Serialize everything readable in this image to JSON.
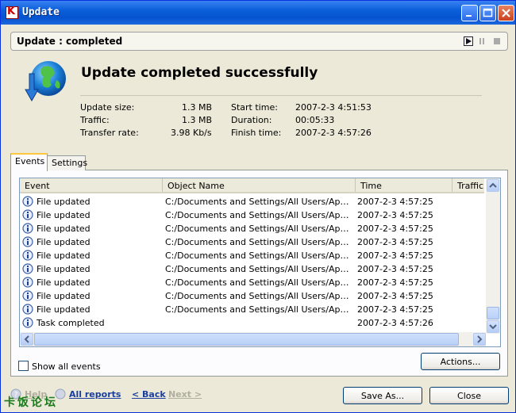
{
  "window": {
    "title": "Update"
  },
  "status": {
    "text": "Update : completed"
  },
  "headline": "Update completed successfully",
  "stats": {
    "update_size_label": "Update size:",
    "update_size_value": "1.3 MB",
    "traffic_label": "Traffic:",
    "traffic_value": "1.3 MB",
    "transfer_rate_label": "Transfer rate:",
    "transfer_rate_value": "3.98 Kb/s",
    "start_time_label": "Start time:",
    "start_time_value": "2007-2-3 4:51:53",
    "duration_label": "Duration:",
    "duration_value": "00:05:33",
    "finish_time_label": "Finish time:",
    "finish_time_value": "2007-2-3 4:57:26"
  },
  "tabs": [
    {
      "label": "Events"
    },
    {
      "label": "Settings"
    }
  ],
  "table": {
    "columns": [
      "Event",
      "Object Name",
      "Time",
      "Traffic"
    ],
    "rows": [
      {
        "event": "File updated",
        "object": "C:/Documents and Settings/All Users/Application Data/Kaspersky",
        "time": "2007-2-3 4:57:25"
      },
      {
        "event": "File updated",
        "object": "C:/Documents and Settings/All Users/Application Data/Kaspersky",
        "time": "2007-2-3 4:57:25"
      },
      {
        "event": "File updated",
        "object": "C:/Documents and Settings/All Users/Application Data/Kaspersky",
        "time": "2007-2-3 4:57:25"
      },
      {
        "event": "File updated",
        "object": "C:/Documents and Settings/All Users/Application Data/Kaspersky",
        "time": "2007-2-3 4:57:25"
      },
      {
        "event": "File updated",
        "object": "C:/Documents and Settings/All Users/Application Data/Kaspersky",
        "time": "2007-2-3 4:57:25"
      },
      {
        "event": "File updated",
        "object": "C:/Documents and Settings/All Users/Application Data/Kaspersky",
        "time": "2007-2-3 4:57:25"
      },
      {
        "event": "File updated",
        "object": "C:/Documents and Settings/All Users/Application Data/Kaspersky",
        "time": "2007-2-3 4:57:25"
      },
      {
        "event": "File updated",
        "object": "C:/Documents and Settings/All Users/Application Data/Kaspersky",
        "time": "2007-2-3 4:57:25"
      },
      {
        "event": "File updated",
        "object": "C:/Documents and Settings/All Users/Application Data/Kaspersky",
        "time": "2007-2-3 4:57:25"
      },
      {
        "event": "Task completed",
        "object": "",
        "time": "2007-2-3 4:57:26"
      }
    ]
  },
  "show_all_events_label": "Show all events",
  "actions_label": "Actions...",
  "footer": {
    "help": "Help",
    "all_reports": "All reports",
    "back": "< Back",
    "next": "Next >",
    "save_as": "Save As...",
    "close": "Close"
  },
  "watermark": "卡饭论坛",
  "colors": {
    "title_bar": "#0a5fd8",
    "accent": "#ffc83c",
    "link": "#1a3f9e"
  }
}
